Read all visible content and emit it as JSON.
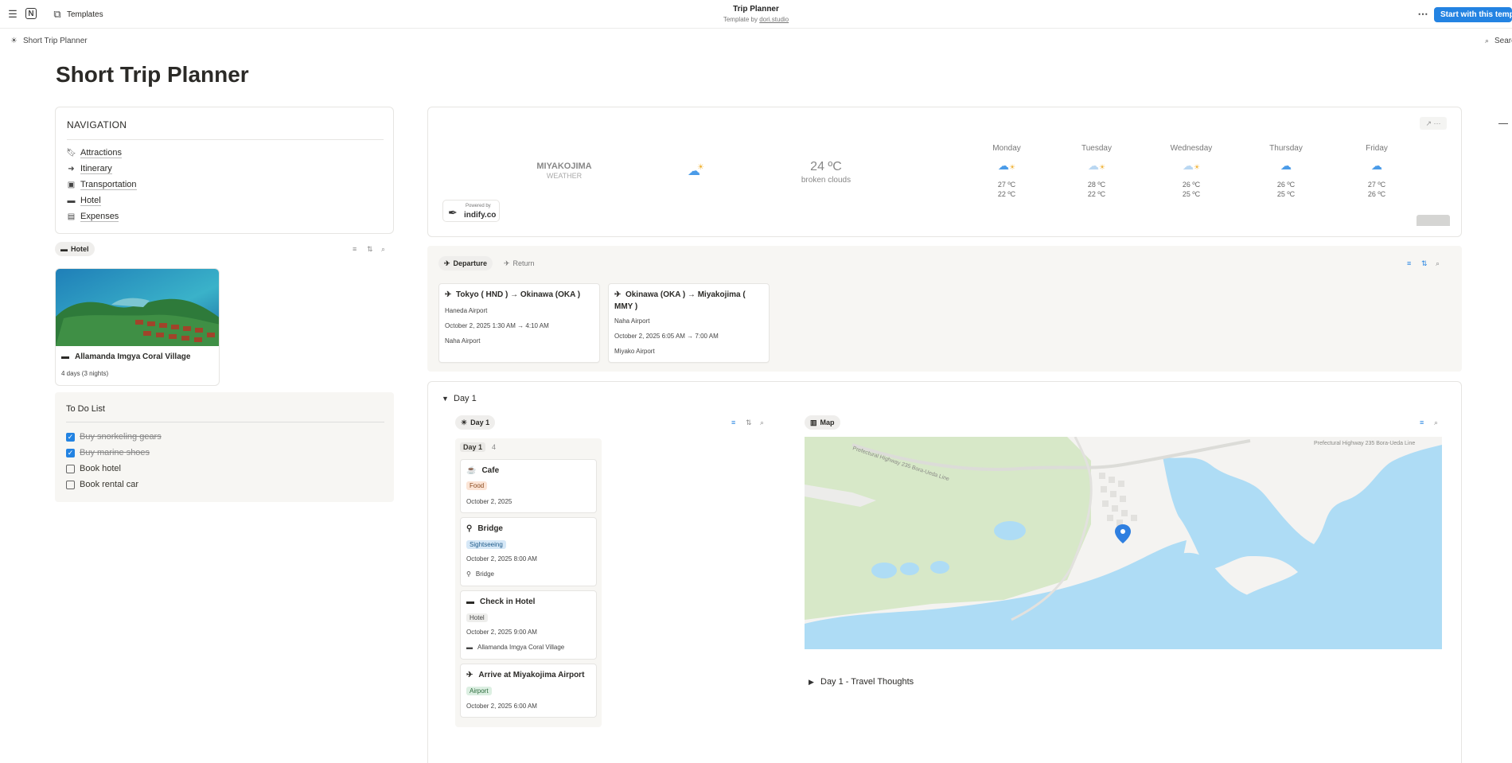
{
  "topbar": {
    "menu_icon": "hamburger-icon",
    "logo_icon": "notion-logo-icon",
    "templates_label": "Templates",
    "title": "Trip Planner",
    "subtitle_prefix": "Template by ",
    "subtitle_link": "dori.studio",
    "more_icon": "more-horizontal-icon",
    "start_button": "Start with this template"
  },
  "breadcrumb": {
    "label": "Short Trip Planner",
    "search_label": "Search"
  },
  "page": {
    "title": "Short Trip Planner"
  },
  "navigation": {
    "heading": "NAVIGATION",
    "items": [
      {
        "label": "Attractions",
        "icon": "bookmark-icon"
      },
      {
        "label": "Itinerary",
        "icon": "arrow-circle-icon"
      },
      {
        "label": "Transportation",
        "icon": "bus-icon"
      },
      {
        "label": "Hotel",
        "icon": "bed-icon"
      },
      {
        "label": "Expenses",
        "icon": "wallet-icon"
      }
    ]
  },
  "hotel_view": {
    "tab_label": "Hotel",
    "card": {
      "name": "Allamanda Imgya Coral Village",
      "duration": "4 days (3 nights)"
    }
  },
  "todo": {
    "heading": "To Do List",
    "items": [
      {
        "label": "Buy snorkeling gears",
        "checked": true
      },
      {
        "label": "Buy marine shoes",
        "checked": true
      },
      {
        "label": "Book hotel",
        "checked": false
      },
      {
        "label": "Book rental car",
        "checked": false
      }
    ]
  },
  "weather": {
    "location": "MIYAKOJIMA",
    "location_sub": "WEATHER",
    "current_temp": "24 ºC",
    "condition": "broken clouds",
    "powered_by": "Powered by",
    "provider": "indify.co",
    "days": [
      {
        "day": "Monday",
        "high": "27 ºC",
        "low": "22 ºC",
        "icon": "sun-cloud-icon"
      },
      {
        "day": "Tuesday",
        "high": "28 ºC",
        "low": "22 ºC",
        "icon": "sun-cloud-icon"
      },
      {
        "day": "Wednesday",
        "high": "26 ºC",
        "low": "25 ºC",
        "icon": "sun-cloud-icon"
      },
      {
        "day": "Thursday",
        "high": "26 ºC",
        "low": "25 ºC",
        "icon": "cloud-icon"
      },
      {
        "day": "Friday",
        "high": "27 ºC",
        "low": "26 ºC",
        "icon": "cloud-icon"
      }
    ]
  },
  "flights": {
    "tabs": [
      "Departure",
      "Return"
    ],
    "cards": [
      {
        "title": "Tokyo ( HND ) → Okinawa (OKA )",
        "from": "Haneda Airport",
        "time": "October 2, 2025 1:30 AM → 4:10 AM",
        "to": "Naha Airport"
      },
      {
        "title": "Okinawa (OKA ) → Miyakojima ( MMY )",
        "from": "Naha Airport",
        "time": "October 2, 2025 6:05 AM → 7:00 AM",
        "to": "Miyako Airport"
      }
    ]
  },
  "day1": {
    "toggle_label": "Day 1",
    "view_tab": "Day 1",
    "group_label": "Day 1",
    "group_count": "4",
    "map_tab": "Map",
    "map_road_labels": [
      "Prefectural Highway 235 Bora-Ueda Line",
      "Prefectural Highway 235 Bora-Ueda Line"
    ],
    "thoughts_label": "Day 1 - Travel Thoughts",
    "cards": [
      {
        "title": "Cafe",
        "icon": "coffee-icon",
        "tag": "Food",
        "date": "October 2, 2025"
      },
      {
        "title": "Bridge",
        "icon": "pin-icon",
        "tag": "Sightseeing",
        "date": "October 2, 2025 8:00 AM",
        "place": "Bridge"
      },
      {
        "title": "Check in Hotel",
        "icon": "bed-icon",
        "tag": "Hotel",
        "date": "October 2, 2025 9:00 AM",
        "place": "Allamanda Imgya Coral Village"
      },
      {
        "title": "Arrive at Miyakojima Airport",
        "icon": "plane-icon",
        "tag": "Airport",
        "date": "October 2, 2025 6:00 AM"
      }
    ]
  },
  "colors": {
    "accent": "#2383e2",
    "food_tag": "#fbe4d5",
    "sight_tag": "#d6e8f7",
    "hotel_tag": "#eeeeec",
    "airport_tag": "#dcefe2",
    "map_land": "#f4f3f1",
    "map_green": "#d7e8c8",
    "map_water": "#aedcf5"
  }
}
